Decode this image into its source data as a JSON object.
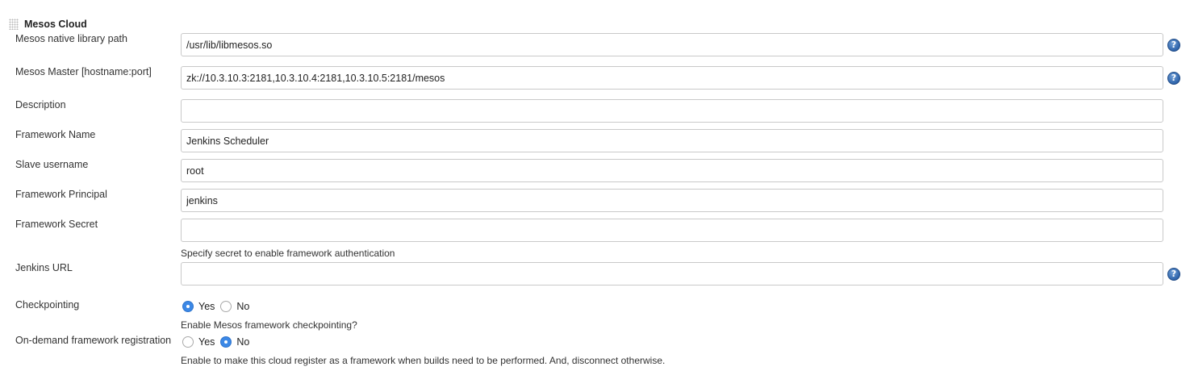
{
  "section": {
    "title": "Mesos Cloud"
  },
  "fields": {
    "native_library_path": {
      "label": "Mesos native library path",
      "value": "/usr/lib/libmesos.so"
    },
    "master": {
      "label": "Mesos Master [hostname:port]",
      "value": "zk://10.3.10.3:2181,10.3.10.4:2181,10.3.10.5:2181/mesos"
    },
    "description": {
      "label": "Description",
      "value": ""
    },
    "framework_name": {
      "label": "Framework Name",
      "value": "Jenkins Scheduler"
    },
    "slave_username": {
      "label": "Slave username",
      "value": "root"
    },
    "framework_principal": {
      "label": "Framework Principal",
      "value": "jenkins"
    },
    "framework_secret": {
      "label": "Framework Secret",
      "value": "",
      "help": "Specify secret to enable framework authentication"
    },
    "jenkins_url": {
      "label": "Jenkins URL",
      "value": ""
    }
  },
  "checkpointing": {
    "label": "Checkpointing",
    "yes_label": "Yes",
    "no_label": "No",
    "selected": "Yes",
    "help": "Enable Mesos framework checkpointing?"
  },
  "on_demand": {
    "label": "On-demand framework registration",
    "yes_label": "Yes",
    "no_label": "No",
    "selected": "No",
    "help": "Enable to make this cloud register as a framework when builds need to be performed. And, disconnect otherwise."
  },
  "help_icon_glyph": "?",
  "colors": {
    "radio_checked": "#3b88e6",
    "help_icon": "#2f64ab",
    "field_border": "#c9c9c9"
  }
}
